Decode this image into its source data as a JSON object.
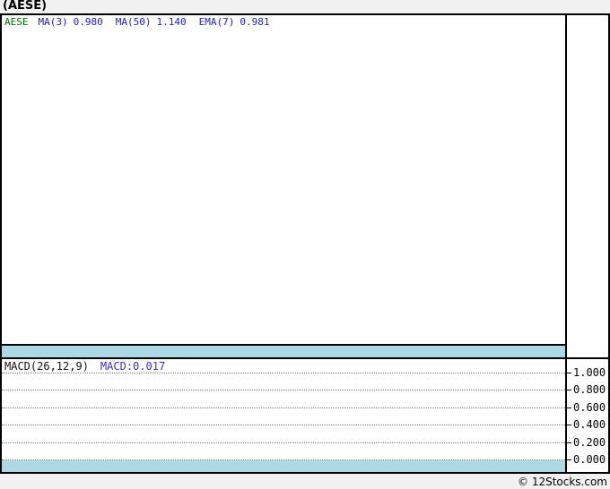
{
  "page": {
    "title": "(AESE)",
    "footer": "© 12Stocks.com"
  },
  "main_chart": {
    "symbol": "AESE",
    "indicators": [
      {
        "label": "MA(3)",
        "value": "0.980"
      },
      {
        "label": "MA(50)",
        "value": "1.140"
      },
      {
        "label": "EMA(7)",
        "value": "0.981"
      }
    ]
  },
  "macd_panel": {
    "label": "MACD(26,12,9)",
    "value_label": "MACD:0.017"
  },
  "colors": {
    "symbol_green": "#007700",
    "indicator_blue": "#2222cc",
    "macd_value_blue": "#3333cc",
    "separator_band_blue": "#add8e6",
    "gridline_gray": "#808080",
    "frame_black": "#000000",
    "page_background": "#f1f1f1"
  },
  "chart_data": [
    {
      "type": "line",
      "panel": "price",
      "legend_symbol": "AESE",
      "series": [
        {
          "name": "MA(3)",
          "last_value": 0.98
        },
        {
          "name": "MA(50)",
          "last_value": 1.14
        },
        {
          "name": "EMA(7)",
          "last_value": 0.981
        }
      ],
      "visible_points": [],
      "grid": false,
      "legend_position": "top-left"
    },
    {
      "type": "line",
      "panel": "macd",
      "name": "MACD(26,12,9)",
      "last_value": 0.017,
      "y_ticks": [
        "1.000",
        "0.800",
        "0.600",
        "0.400",
        "0.200",
        "0.000"
      ],
      "ylim": [
        -0.07,
        1.09
      ],
      "visible_points": [],
      "grid": "dotted-horizontal",
      "legend_position": "top-left",
      "axis_position": "right"
    }
  ]
}
